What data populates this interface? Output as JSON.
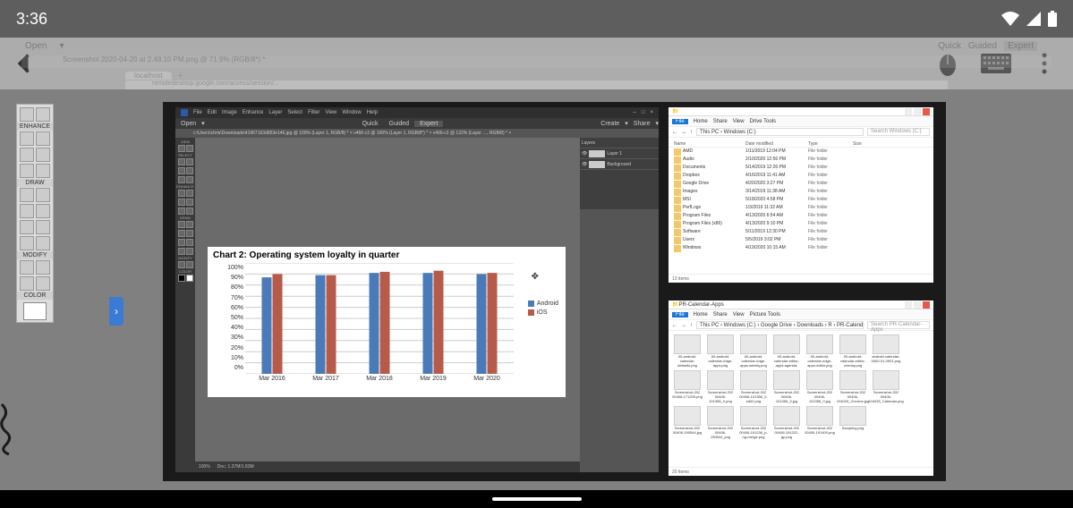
{
  "status": {
    "time": "3:36"
  },
  "faint_host": {
    "open_label": "Open",
    "modes": [
      "Quick",
      "Guided",
      "Expert"
    ],
    "doc_tab": "Screenshot 2020-04-20 at 2.48.10 PM.png @ 71.9% (RGB/8*) *",
    "browser_tab": "localhost",
    "address": "remotedesktop.google.com/access/session/..."
  },
  "outer_palette": {
    "sections": [
      "ENHANCE",
      "DRAW",
      "MODIFY",
      "COLOR"
    ]
  },
  "pse": {
    "menus": [
      "File",
      "Edit",
      "Image",
      "Enhance",
      "Layer",
      "Select",
      "Filter",
      "View",
      "Window",
      "Help"
    ],
    "open_label": "Open",
    "modes": [
      "Quick",
      "Guided",
      "Expert"
    ],
    "right_actions": [
      "Create",
      "Share"
    ],
    "doc_tabs": "c:\\Users\\chris\\Downloads\\41967163d853e146.jpg @ 100% (Layer 1, RGB/8) *  ×    v466-c2 @ 100% (Layer 1, RGB/8*) *  ×    v466-c2 @ 122% (Layer …, RGB/8) *  ×",
    "layers": {
      "header": "Layers",
      "items": [
        "Layer 1",
        "Background"
      ]
    },
    "status": {
      "zoom": "100%",
      "doc": "Doc: 1.37M/1.83M"
    },
    "left_sections": [
      "VIEW",
      "SELECT",
      "ENHANCE",
      "DRAW",
      "MODIFY",
      "COLOR"
    ]
  },
  "chart_data": {
    "type": "bar",
    "title": "Chart 2: Operating system loyalty in quarter",
    "categories": [
      "Mar 2016",
      "Mar 2017",
      "Mar 2018",
      "Mar 2019",
      "Mar 2020"
    ],
    "series": [
      {
        "name": "Android",
        "values": [
          87,
          89,
          91,
          91,
          90
        ]
      },
      {
        "name": "iOS",
        "values": [
          90,
          89,
          92,
          93,
          91
        ]
      }
    ],
    "ylabel": "",
    "ylim": [
      0,
      100
    ],
    "yticks": [
      0,
      10,
      20,
      30,
      40,
      50,
      60,
      70,
      80,
      90,
      100
    ],
    "colors": {
      "Android": "#4a7ab8",
      "iOS": "#b85a4a"
    }
  },
  "explorer_top": {
    "ribbon": [
      "File",
      "Home",
      "Share",
      "View",
      "Drive Tools"
    ],
    "breadcrumb": "This PC › Windows (C:)",
    "search_placeholder": "Search Windows (C:)",
    "columns": [
      "Name",
      "Date modified",
      "Type",
      "Size"
    ],
    "rows": [
      {
        "name": "AMD",
        "date": "1/11/2019 12:04 PM",
        "type": "File folder"
      },
      {
        "name": "Audio",
        "date": "2/10/2020 12:56 PM",
        "type": "File folder"
      },
      {
        "name": "Documents",
        "date": "5/14/2019 12:26 PM",
        "type": "File folder"
      },
      {
        "name": "Dropbox",
        "date": "4/16/2019 11:41 AM",
        "type": "File folder"
      },
      {
        "name": "Google Drive",
        "date": "4/20/2020 3:27 PM",
        "type": "File folder"
      },
      {
        "name": "Images",
        "date": "3/14/2019 11:38 AM",
        "type": "File folder"
      },
      {
        "name": "MSI",
        "date": "5/18/2020 4:58 PM",
        "type": "File folder"
      },
      {
        "name": "PerfLogs",
        "date": "1/3/2019 11:32 AM",
        "type": "File folder"
      },
      {
        "name": "Program Files",
        "date": "4/13/2020 6:54 AM",
        "type": "File folder"
      },
      {
        "name": "Program Files (x86)",
        "date": "4/13/2020 9:10 PM",
        "type": "File folder"
      },
      {
        "name": "Software",
        "date": "5/11/2019 12:30 PM",
        "type": "File folder"
      },
      {
        "name": "Users",
        "date": "5/5/2019 3:02 PM",
        "type": "File folder"
      },
      {
        "name": "Windows",
        "date": "4/19/2020 10:15 AM",
        "type": "File folder"
      }
    ],
    "status": "13 items"
  },
  "explorer_bottom": {
    "title": "PR-Calendar-Apps",
    "ribbon": [
      "File",
      "Home",
      "Share",
      "View",
      "Picture Tools"
    ],
    "breadcrumb": "This PC › Windows (C:) › Google Drive › Downloads › R › PR-Calendar-Apps",
    "search_placeholder": "Search PR-Calendar-Apps",
    "thumbs": [
      "00-android-calendar-defaults.png",
      "00-android-calendar-edge-apps.png",
      "00-android-calendar-edge-apps-weekly.png",
      "00-android-calendar-editor-apps-agenda-wx.png",
      "00-android-calendar-edge-apps-editor.png",
      "00-android-calendar-editor-overlay.png",
      "android-calendar-0400-01-0901.png",
      "Screenshot-202 00406-171205.png",
      "Screenshot-202 00406-101356_0.png",
      "Screenshot-202 00406-101356_0-edit2.png",
      "Screenshot-202 00406-101356_0.jpg",
      "Screenshot-202 00406-101356_0.jpg",
      "Screenshot-202 00406-104033_Chrome.jpg",
      "Screenshot-202 00406-104033_Calendar.png",
      "Screenshot-202 00406-190544.jpg",
      "Screenshot-202 00406-190544_png",
      "Screenshot-202 00406-191236_p-ng-merge.png",
      "Screenshot-202 00406-191322-gp.png",
      "Screenshot-202 00406-191400.png",
      "Sampling.png"
    ],
    "status": "20 items"
  }
}
